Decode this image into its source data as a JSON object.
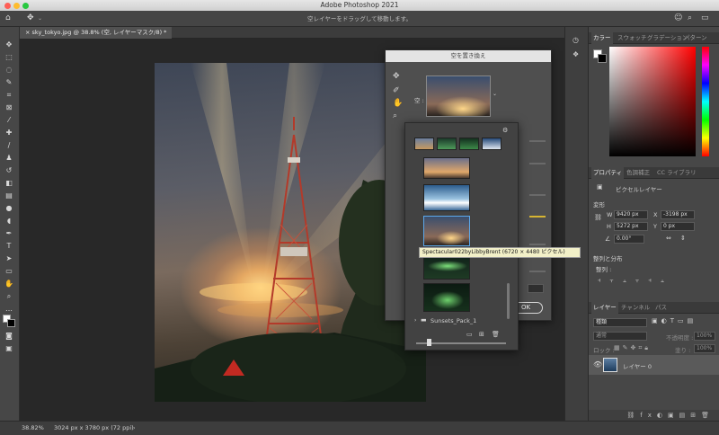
{
  "app": {
    "title": "Adobe Photoshop 2021"
  },
  "options_bar": {
    "hint": "空レイヤーをドラッグして移動します。"
  },
  "document": {
    "tab_title": "sky_tokyo.jpg @ 38.8% (空, レイヤーマスク/8) *",
    "close_glyph": "×"
  },
  "dialog": {
    "title": "空を置き換え",
    "sky_label": "空 :",
    "ok_label": "OK",
    "folder_label": "Sunsets_Pack_1",
    "settings_glyph": "⚙",
    "tooltip": "Spectacular022byLibbyBrent (6720 × 4480 ピクセル)"
  },
  "color_panel": {
    "tabs": [
      "カラー",
      "スウォッチ",
      "グラデーション",
      "パターン"
    ]
  },
  "properties_panel": {
    "tabs": [
      "プロパティ",
      "色調補正",
      "CC ライブラリ"
    ],
    "layer_type": "ピクセルレイヤー",
    "transform_heading": "変形",
    "w_label": "W",
    "w_value": "9420 px",
    "x_label": "X",
    "x_value": "-3198 px",
    "h_label": "H",
    "h_value": "5272 px",
    "y_label": "Y",
    "y_value": "0 px",
    "angle_value": "0.00°",
    "align_heading": "整列と分布",
    "align_label": "整列 :"
  },
  "layers_panel": {
    "tabs": [
      "レイヤー",
      "チャンネル",
      "パス"
    ],
    "filter_placeholder": "種類",
    "blend_mode": "通常",
    "opacity_label": "不透明度 :",
    "opacity_value": "100%",
    "lock_label": "ロック :",
    "fill_label": "塗り :",
    "fill_value": "100%",
    "layer_name": "レイヤー 0"
  },
  "status_bar": {
    "zoom": "38.82%",
    "doc_info": "3024 px x 3780 px (72 ppi)"
  },
  "colors": {
    "chrome": "#535353",
    "canvas": "#282828",
    "accent": "#2d8ceb"
  }
}
